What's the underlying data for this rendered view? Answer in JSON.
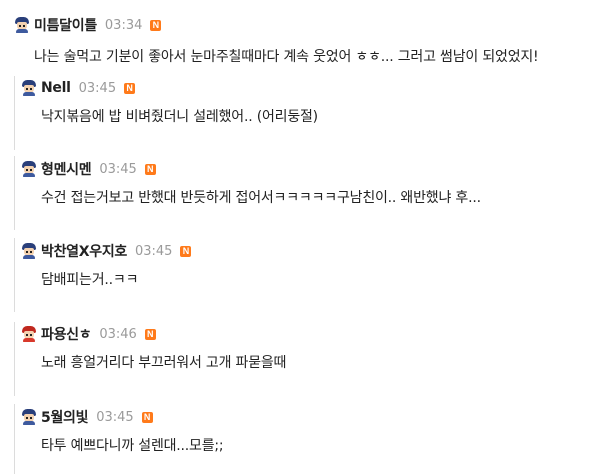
{
  "comments": [
    {
      "nick": "미틈달이틀",
      "time": "03:34",
      "badge": "N",
      "hair": "#2a3f7a",
      "shirt": "#3e5a9e",
      "text": "나는 술먹고 기분이 좋아서 눈마주칠때마다 계속 웃었어 ㅎㅎ... 그러고 썸남이 되었었지!"
    },
    {
      "nick": "Nell",
      "time": "03:45",
      "badge": "N",
      "hair": "#2a3f7a",
      "shirt": "#3e5a9e",
      "text": "낙지볶음에 밥 비벼줬더니 설레했어.. (어리둥절)"
    },
    {
      "nick": "형멘시멘",
      "time": "03:45",
      "badge": "N",
      "hair": "#2a3f7a",
      "shirt": "#3e5a9e",
      "text": "수건 접는거보고 반했대 반듯하게 접어서ㅋㅋㅋㅋㅋ구남친이.. 왜반했냐 후..."
    },
    {
      "nick": "박찬열X우지호",
      "time": "03:45",
      "badge": "N",
      "hair": "#2a3f7a",
      "shirt": "#3e5a9e",
      "text": "담배피는거..ㅋㅋ"
    },
    {
      "nick": "파용신ㅎ",
      "time": "03:46",
      "badge": "N",
      "hair": "#c0281e",
      "shirt": "#d8392b",
      "text": "노래 흥얼거리다 부끄러워서 고개 파묻을때"
    },
    {
      "nick": "5월의빛",
      "time": "03:45",
      "badge": "N",
      "hair": "#2a3f7a",
      "shirt": "#3e5a9e",
      "text": "타투 예쁘다니까 설렌대...모를;;"
    }
  ]
}
